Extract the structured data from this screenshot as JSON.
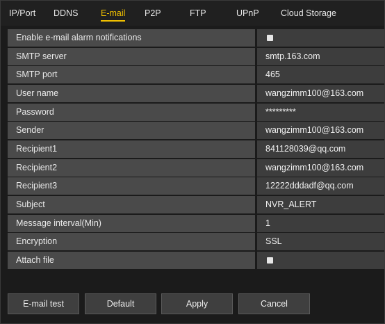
{
  "tabs": [
    {
      "label": "IP/Port"
    },
    {
      "label": "DDNS"
    },
    {
      "label": "E-mail",
      "active": true
    },
    {
      "label": "P2P"
    },
    {
      "label": "FTP"
    },
    {
      "label": "UPnP"
    },
    {
      "label": "Cloud Storage"
    }
  ],
  "fields": {
    "enable": {
      "label": "Enable e-mail alarm notifications",
      "checked": false
    },
    "smtp_server": {
      "label": "SMTP server",
      "value": "smtp.163.com"
    },
    "smtp_port": {
      "label": "SMTP port",
      "value": "465"
    },
    "user_name": {
      "label": "User name",
      "value": "wangzimm100@163.com"
    },
    "password": {
      "label": "Password",
      "value": "*********"
    },
    "sender": {
      "label": "Sender",
      "value": "wangzimm100@163.com"
    },
    "recipient1": {
      "label": "Recipient1",
      "value": "841128039@qq.com"
    },
    "recipient2": {
      "label": "Recipient2",
      "value": "wangzimm100@163.com"
    },
    "recipient3": {
      "label": "Recipient3",
      "value": "12222dddadf@qq.com"
    },
    "subject": {
      "label": "Subject",
      "value": "NVR_ALERT"
    },
    "interval": {
      "label": "Message interval(Min)",
      "value": "1"
    },
    "encryption": {
      "label": "Encryption",
      "value": "SSL"
    },
    "attach": {
      "label": "Attach file",
      "checked": false
    }
  },
  "buttons": {
    "test": "E-mail test",
    "default": "Default",
    "apply": "Apply",
    "cancel": "Cancel"
  },
  "colors": {
    "accent": "#f2c200"
  }
}
